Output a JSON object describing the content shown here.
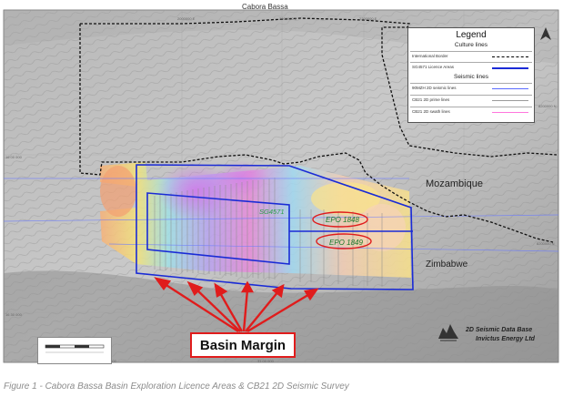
{
  "map": {
    "title": "Cabora Bassa",
    "countries": {
      "mozambique": "Mozambique",
      "zimbabwe": "Zimbabwe"
    },
    "areas": {
      "sg": "SG4571",
      "epo1848": "EPO 1848",
      "epo1849": "EPO 1849"
    },
    "grid_labels": {
      "n1": "2000000 E",
      "n2": "2200000 E",
      "n3": "2000000 E",
      "e1": "16 00 000",
      "e2": "16 30 000",
      "e3": "8200000 N",
      "e4": "8200000 N",
      "b1": "30 00 000",
      "b2": "31 00 000"
    }
  },
  "legend": {
    "title": "Legend",
    "culture_heading": "Culture lines",
    "culture": [
      {
        "label": "International Border",
        "color": "#000000",
        "style": "dashed"
      },
      {
        "label": "SG4571 Licence Areas",
        "color": "#1a2bd6",
        "style": "solid"
      }
    ],
    "seismic_heading": "Seismic lines",
    "seismic": [
      {
        "label": "90MZH 2D seismic lines",
        "color": "#5b6bff",
        "style": "solid"
      },
      {
        "label": "CB21 2D prime lines",
        "color": "#9a9a9a",
        "style": "solid"
      },
      {
        "label": "CB21 2D swath lines",
        "color": "#ff77dd",
        "style": "solid"
      }
    ]
  },
  "callout": {
    "label": "Basin Margin",
    "color": "#e01c1c"
  },
  "branding": {
    "line1": "2D Seismic Data Base",
    "line2": "Invictus Energy Ltd"
  },
  "caption": "Figure 1 - Cabora Bassa Basin Exploration Licence Areas & CB21 2D Seismic Survey"
}
